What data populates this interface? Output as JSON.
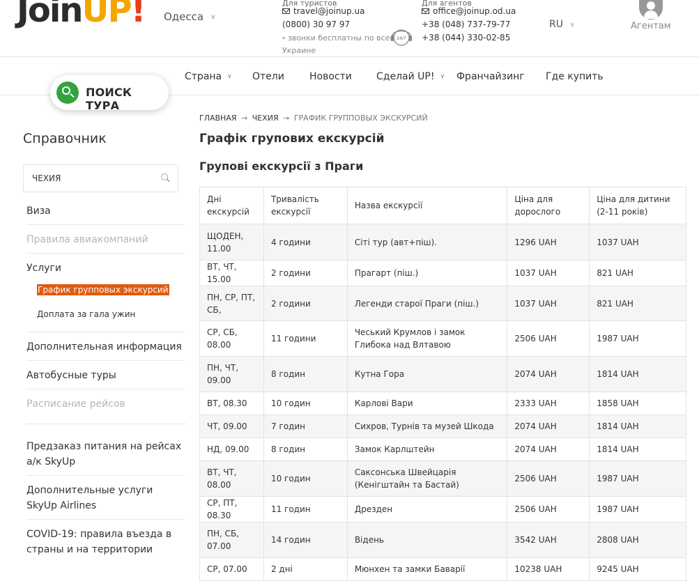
{
  "header": {
    "logo": {
      "join": "Join",
      "up": "UP",
      "ex": "!"
    },
    "city": "Одесса",
    "tourists": {
      "title": "Для туристов",
      "email": "travel@joinup.ua",
      "phone": "(0800) 30 97 97",
      "note_line1": "звонки бесплатны по всей",
      "note_line2": "Украине",
      "note_dash": "-"
    },
    "agents": {
      "title": "Для агентов",
      "email": "office@joinup.od.ua",
      "phone1": "+38 (048) 737-79-77",
      "phone2": "+38 (044) 330-02-85"
    },
    "support_icon_label": "24/7",
    "language": "RU",
    "agent_link": "Агентам"
  },
  "nav": {
    "search_tour": "ПОИСК ТУРА",
    "items": [
      {
        "label": "Страна",
        "dropdown": true
      },
      {
        "label": "Отели",
        "dropdown": false
      },
      {
        "label": "Новости",
        "dropdown": false
      },
      {
        "label": "Сделай UP!",
        "dropdown": true
      },
      {
        "label": "Франчайзинг",
        "dropdown": false
      },
      {
        "label": "Где купить",
        "dropdown": false
      }
    ]
  },
  "sidebar": {
    "title": "Справочник",
    "search_value": "ЧЕХИЯ",
    "links": {
      "visa": "Виза",
      "airline_rules": "Правила авиакомпаний",
      "services": "Услуги",
      "sub_active": "График групповых экскурсий",
      "sub_dinner": "Доплата за гала ужин",
      "extra_info": "Дополнительная информация",
      "bus_tours": "Автобусные туры",
      "flight_schedule": "Расписание рейсов",
      "meal_preorder": "Предзаказ питания на рейсах а/к SkyUp",
      "skyup_services": "Дополнительные услуги SkyUp Airlines",
      "covid": "COVID-19: правила въезда в страны и на территории"
    }
  },
  "breadcrumb": {
    "home": "ГЛАВНАЯ",
    "arrow": "→",
    "country": "ЧЕХИЯ",
    "current": "ГРАФИК ГРУППОВЫХ ЭКСКУРСИЙ"
  },
  "page_title": "Графік групових екскурсій",
  "sub_title": "Групові екскурсії з Праги",
  "table": {
    "headers": [
      "Дні екскурсій",
      "Тривалість екскурсії",
      "Назва екскурсії",
      "Ціна для дорослого",
      "Ціна для дитини (2-11 років)"
    ],
    "rows": [
      [
        "ЩОДЕН, 11.00",
        "4 години",
        "Сіті тур (авт+піш).",
        "1296 UAH",
        "1037 UAH"
      ],
      [
        "ВТ, ЧТ, 15.00",
        "2 години",
        "Прагарт (піш.)",
        "1037 UAH",
        "821 UAH"
      ],
      [
        "ПН, СР, ПТ, СБ,",
        "2 години",
        "Легенди старої Праги (піш.)",
        "1037 UAH",
        "821 UAH"
      ],
      [
        "СР, СБ, 08.00",
        "11 години",
        "Чеський Крумлов і замок Глибока над Влтавою",
        "2506 UAH",
        "1987 UAH"
      ],
      [
        "ПН, ЧТ, 09.00",
        "8 годин",
        "Кутна Гора",
        "2074 UAH",
        "1814 UAH"
      ],
      [
        "ВТ, 08.30",
        "10 годин",
        "Карлові Вари",
        "2333 UAH",
        "1858 UAH"
      ],
      [
        "ЧТ, 09.00",
        "7 годин",
        "Сихров, Турнів та музей Шкода",
        "2074 UAH",
        "1814 UAH"
      ],
      [
        "НД, 09.00",
        "8 годин",
        "Замок Карлштейн",
        "2074 UAH",
        "1814 UAH"
      ],
      [
        "ВТ, ЧТ, 08.00",
        "10 годин",
        "Саксонська Швейцарія (Кенігштайн та Бастай)",
        "2506 UAH",
        "1987 UAH"
      ],
      [
        "СР, ПТ, 08.30",
        "11 годин",
        "Дрезден",
        "2506 UAH",
        "1987 UAH"
      ],
      [
        "ПН, СБ, 07.00",
        "14 годин",
        "Відень",
        "3542 UAH",
        "2808 UAH"
      ],
      [
        "СР, 07.00",
        "2 дні",
        "Мюнхен та замки Баварії",
        "10238 UAH",
        "9245 UAH"
      ]
    ]
  }
}
